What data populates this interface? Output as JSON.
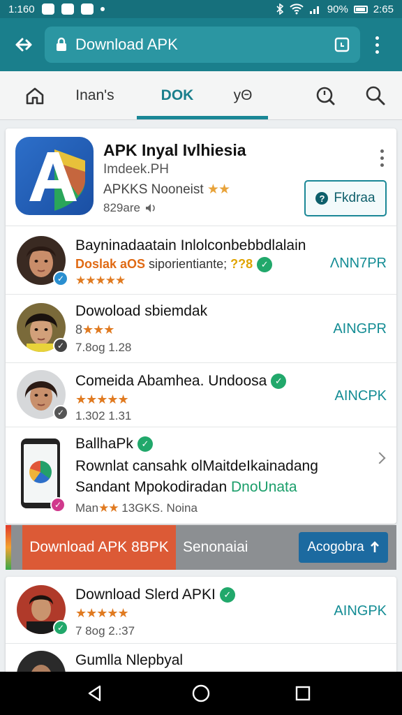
{
  "status_bar": {
    "time": "1:160",
    "battery": "90%",
    "clock_right": "2:65"
  },
  "app_bar": {
    "url_text": "Download APK"
  },
  "nav": {
    "tab_1": "Inan's",
    "tab_2": "DOK",
    "tab_3": "yΘ"
  },
  "hero": {
    "title": "APK Inyal Ivlhiesia",
    "developer": "Imdeek.PH",
    "rating_text": "APKKS Nooneist",
    "rating_stars": "★★",
    "size_text": "829are",
    "button_label": "Fkdraa"
  },
  "rows": [
    {
      "title": "Bayninadaatain Inlolconbebbdlalain",
      "line1_orange": "Doslak aOS",
      "line1_text": " siporientiante;",
      "line1_yellow": " ??8",
      "line2_stars": "★★★",
      "line2_empty": "★★",
      "action": "ΛNN7PR"
    },
    {
      "title": "Dowoload sbiemdak",
      "line1_prefix": "8",
      "line1_stars": "★★★",
      "line2": "7.8og 1.28",
      "action": "AINGPR"
    },
    {
      "title": "Comeida Abamhea. Undoosa",
      "line1_stars": "★★★★★",
      "line2": "1.302 1.31",
      "action": "AINCPK"
    },
    {
      "title": "BallhaPk",
      "line1": "Rownlat cansahk olMaitdeIkainadang",
      "line2_text": "Sandant Mpokodiradan ",
      "line2_accent": "DnoUnata",
      "line3_text": "Man",
      "line3_stars": "★★",
      "line3_more": " 13GKS.  Noina"
    }
  ],
  "promo": {
    "tab_label": "Download APK 8BPK",
    "text": "Senonaiai",
    "button_label": "Acogobra"
  },
  "card2_rows": [
    {
      "title": "Download Slerd APKI",
      "stars": "★★★★",
      "stars_empty": "★",
      "line2": "7 8og 2.:37",
      "action": "AINGPK"
    },
    {
      "title": "Gumlla Nlepbyal"
    }
  ],
  "colors": {
    "status_bar": "#16707c",
    "app_bar": "#1a7f8c",
    "accent_teal": "#138c94",
    "promo_orange": "#dc5a36",
    "promo_button": "#1c6aa0"
  },
  "icons": [
    "back-arrow-icon",
    "lock-icon",
    "tabs-icon",
    "overflow-menu-icon",
    "home-icon",
    "search-icon",
    "back-triangle-icon",
    "home-circle-icon",
    "recents-square-icon"
  ]
}
